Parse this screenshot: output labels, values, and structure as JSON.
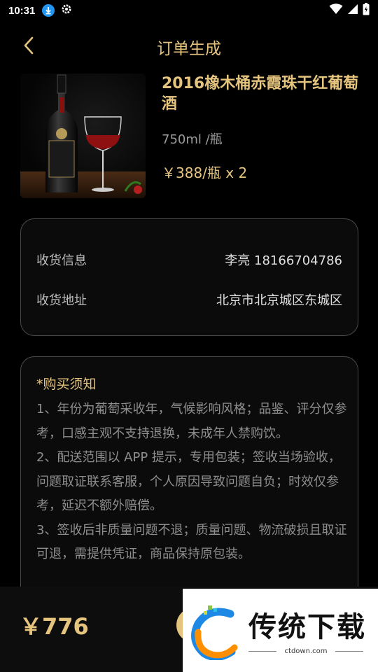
{
  "status_bar": {
    "time": "10:31"
  },
  "header": {
    "title": "订单生成"
  },
  "product": {
    "name": "2016橡木桶赤霞珠干红葡萄酒",
    "spec": "750ml /瓶",
    "price": "￥388/瓶 x 2"
  },
  "receiver": {
    "contact_label": "收货信息",
    "contact_value": "李亮 18166704786",
    "address_label": "收货地址",
    "address_value": "北京市北京城区东城区"
  },
  "notice": {
    "title": "*购买须知",
    "text": "1、年份为葡萄采收年，气候影响风格；品鉴、评分仅参考，口感主观不支持退换，未成年人禁购饮。\n2、配送范围以 APP 提示，专用包装；签收当场验收，问题取证联系客服，个人原因导致问题自负；时效仅参考，延迟不额外赔偿。\n3、签收后非质量问题不退；质量问题、物流破损且取证可退，需提供凭证，商品保持原包装。"
  },
  "footer": {
    "total": "￥776"
  },
  "watermark": {
    "brand": "传统下载",
    "url": "ctdown.com"
  },
  "colors": {
    "accent": "#e5c47e",
    "background": "#000000",
    "card_border": "#4a4a4a"
  }
}
